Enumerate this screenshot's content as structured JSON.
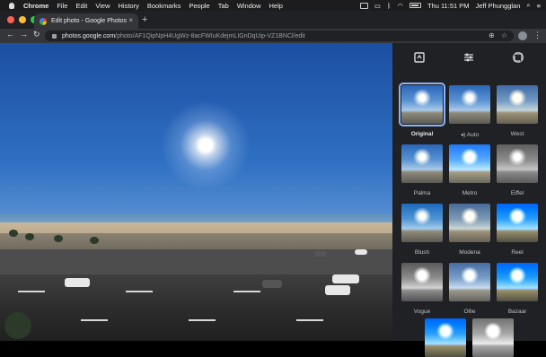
{
  "menubar": {
    "app": "Chrome",
    "items": [
      "File",
      "Edit",
      "View",
      "History",
      "Bookmarks",
      "People",
      "Tab",
      "Window",
      "Help"
    ],
    "clock": "Thu 11:51 PM",
    "user": "Jeff Phungglan"
  },
  "tab": {
    "title": "Edit photo - Google Photos",
    "close": "×",
    "new_tab": "+"
  },
  "toolbar": {
    "back": "←",
    "forward": "→",
    "reload": "↻",
    "url_host": "photos.google.com",
    "url_path": "/photo/AF1QipNpH4UgWz-8acFWIuKdejmLIGnDqUip-VZ1BNCl/edit",
    "menu": "⋮"
  },
  "panel": {
    "tabs": [
      "filters-tab",
      "adjust-tab",
      "crop-rotate-tab"
    ],
    "filters": [
      {
        "label": "Original",
        "variant": "normal",
        "selected": true
      },
      {
        "label": "Auto",
        "variant": "normal",
        "selected": false,
        "icon": "auto-icon"
      },
      {
        "label": "West",
        "variant": "warm",
        "selected": false
      },
      {
        "label": "Palma",
        "variant": "normal",
        "selected": false
      },
      {
        "label": "Metro",
        "variant": "bright",
        "selected": false
      },
      {
        "label": "Eiffel",
        "variant": "bw",
        "selected": false
      },
      {
        "label": "Blush",
        "variant": "normal",
        "selected": false
      },
      {
        "label": "Modena",
        "variant": "warm",
        "selected": false
      },
      {
        "label": "Reel",
        "variant": "deep",
        "selected": false
      },
      {
        "label": "Vogue",
        "variant": "bw",
        "selected": false
      },
      {
        "label": "Ollie",
        "variant": "faded",
        "selected": false
      },
      {
        "label": "Bazaar",
        "variant": "deep",
        "selected": false
      },
      {
        "label": "",
        "variant": "deep",
        "selected": false
      },
      {
        "label": "",
        "variant": "bw",
        "selected": false
      }
    ]
  }
}
